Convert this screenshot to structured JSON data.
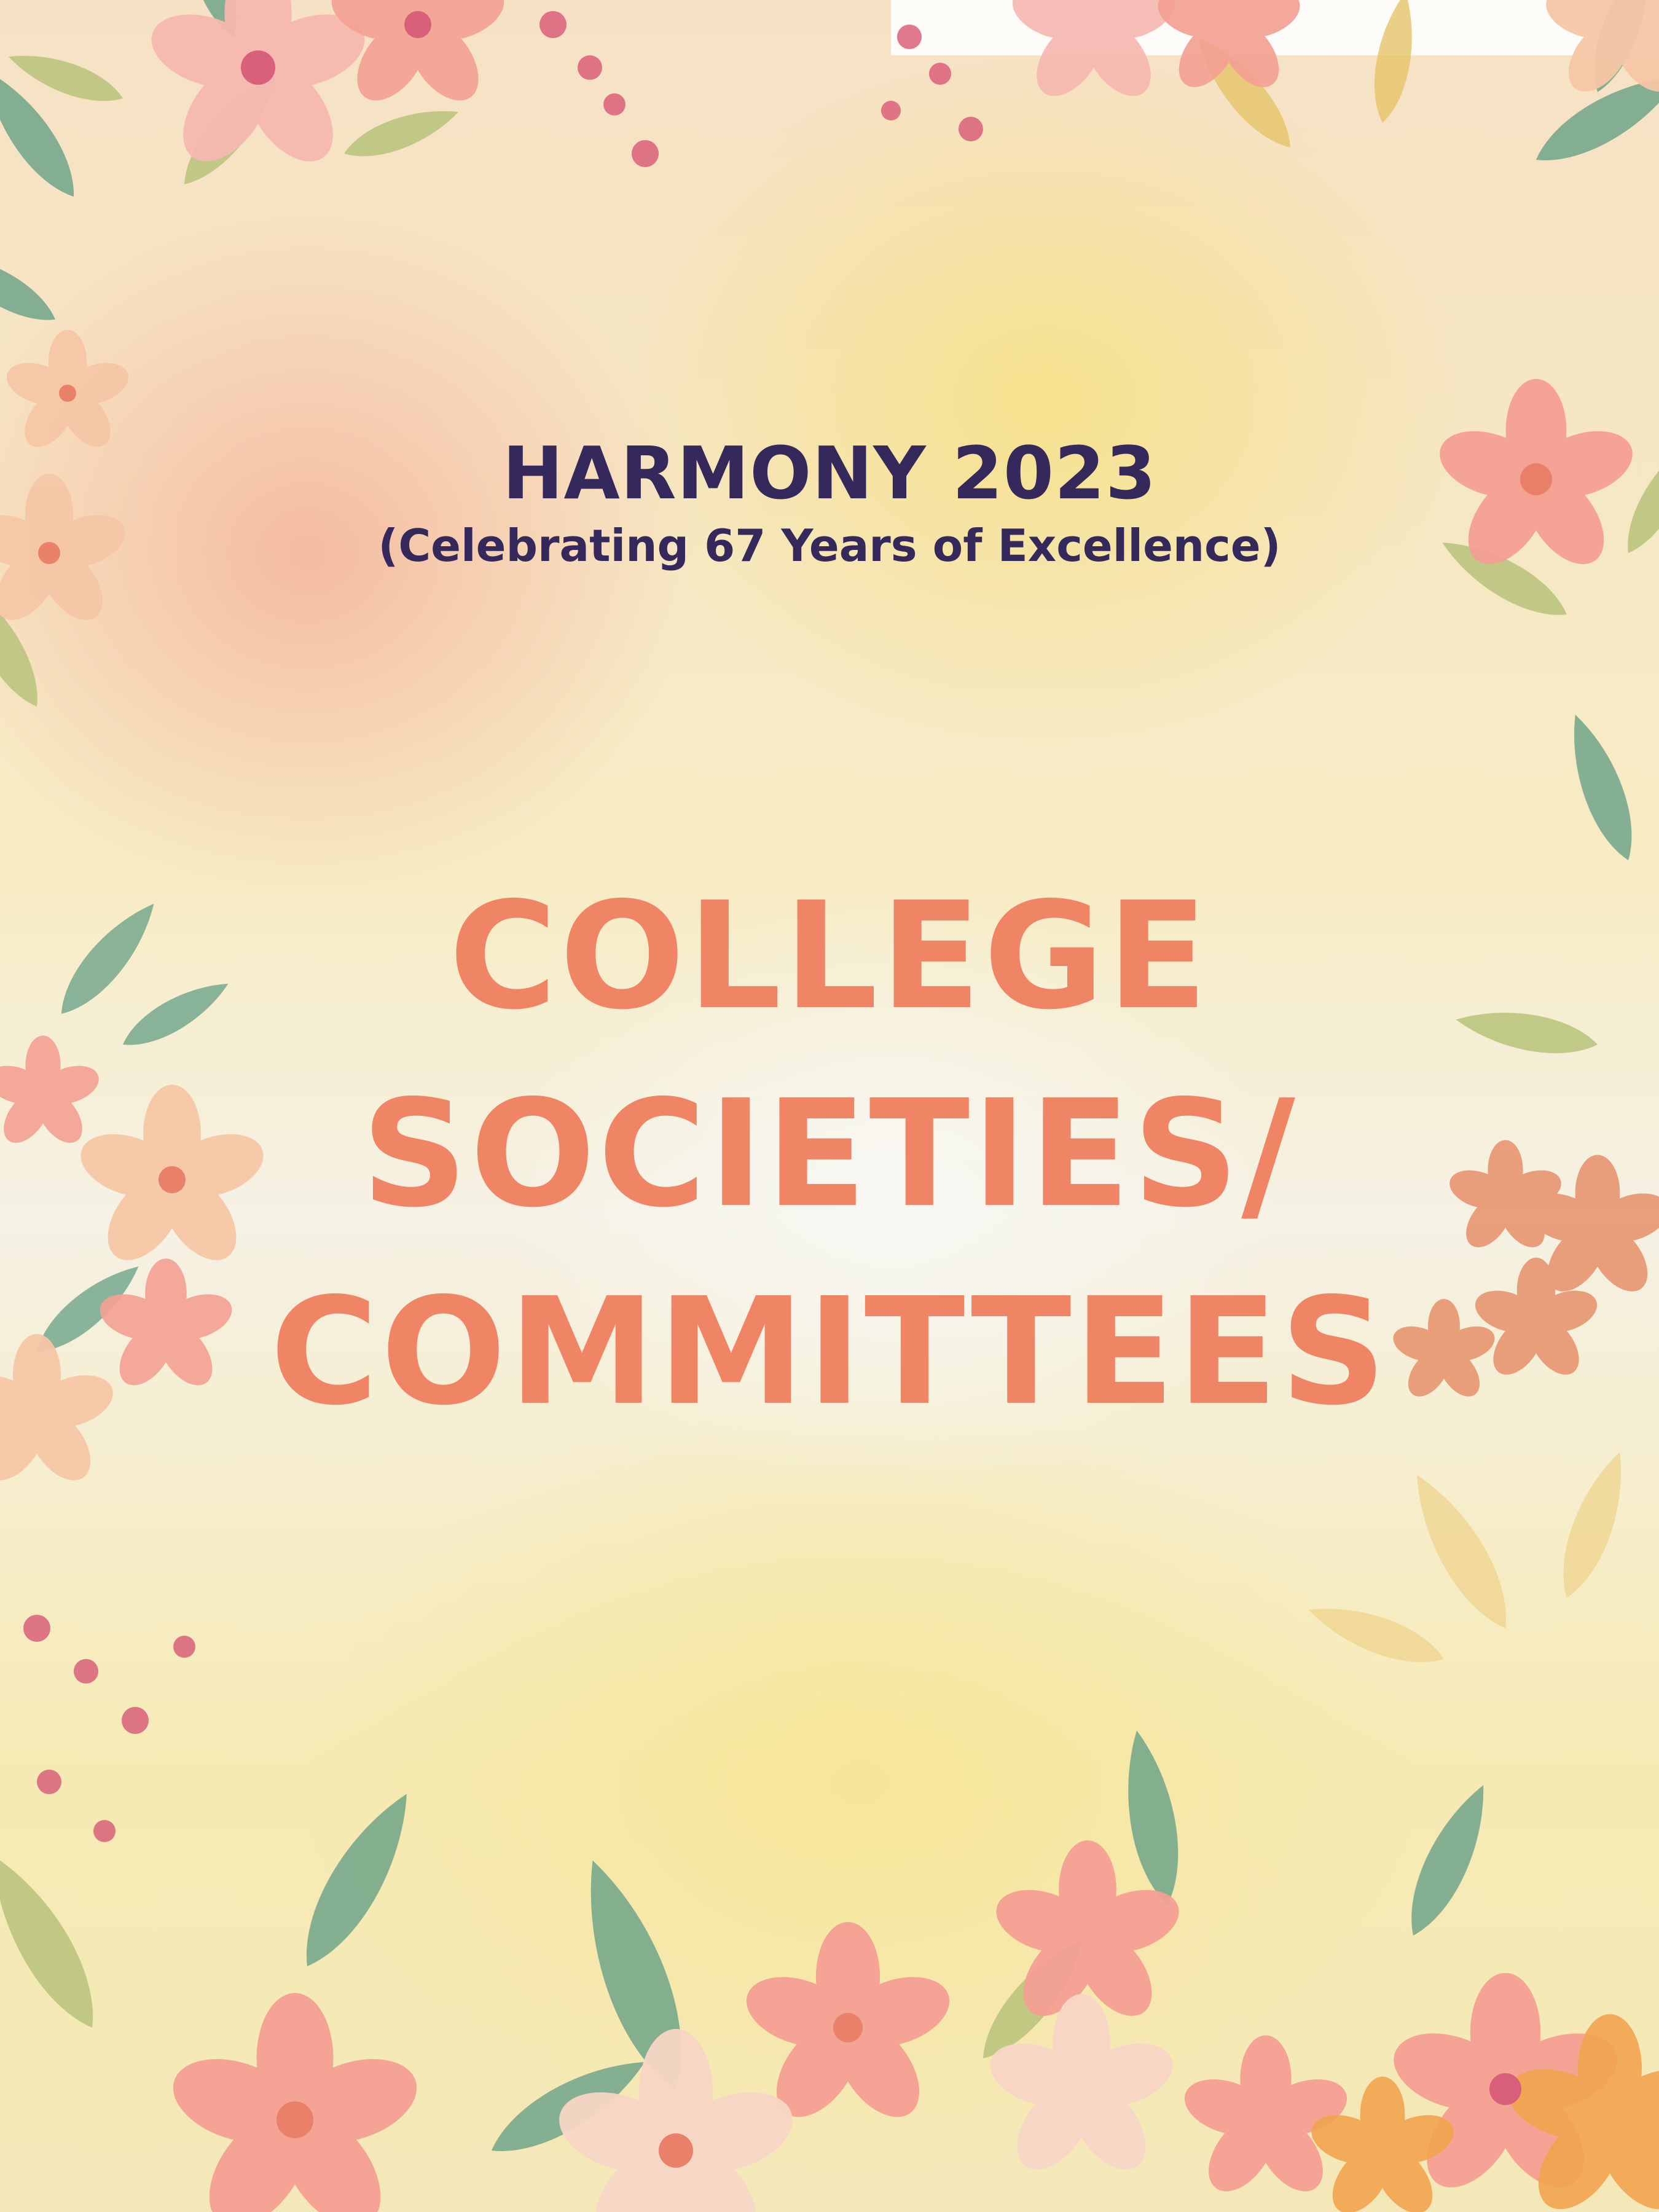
{
  "cover": {
    "event_title": "HARMONY 2023",
    "event_subtitle": "(Celebrating 67 Years of Excellence)",
    "heading_lines": [
      "COLLEGE",
      "SOCIETIES/",
      "COMMITTEES"
    ]
  },
  "colors": {
    "title": "#34295a",
    "heading": "#f08566",
    "leaf_green": "#6fa48a",
    "leaf_olive": "#b8c27a",
    "flower_pink": "#f4a093",
    "flower_peach": "#f6c7a6",
    "flower_magenta": "#d9607a"
  },
  "decoration": {
    "icons": [
      "floral-border-icon",
      "palm-leaf-icon",
      "blossom-icon",
      "berry-branch-icon"
    ]
  }
}
